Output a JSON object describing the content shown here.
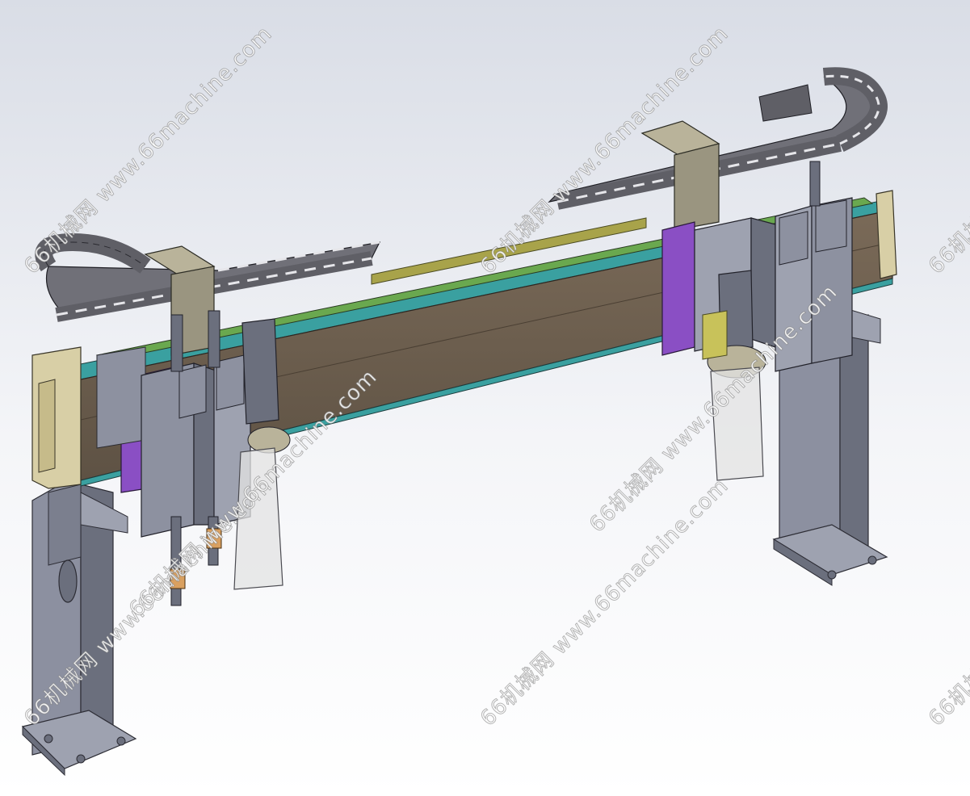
{
  "watermark": {
    "text": "66机械网 www.66machine.com",
    "repeats": [
      "66机械网 www.66machine.com",
      "66机械网 www.66machine.com",
      "66机械网 www.66machine.com",
      "66机械网 www.66machine.com",
      "66机械网 www.66machine.com",
      "66机械网 www.66machine.com",
      "66机械网 www.66machine.com",
      "66机械网 www.66machine.com"
    ]
  },
  "palette": {
    "background_top": "#d9dde6",
    "background_bottom": "#ffffff",
    "leg_grey": "#7d8190",
    "beam_brown": "#6e5f4f",
    "rail_teal": "#3aa0a0",
    "rail_green": "#6aa84f",
    "rail_yellow": "#a8a34a",
    "plate_purple": "#8a4fc4",
    "end_cap_tan": "#d8cfa6",
    "chain_grey": "#5f5f66",
    "bracket_tan": "#b9b39a",
    "nozzle_orange": "#d9a060",
    "cup_glass": "#e3e3e3"
  }
}
